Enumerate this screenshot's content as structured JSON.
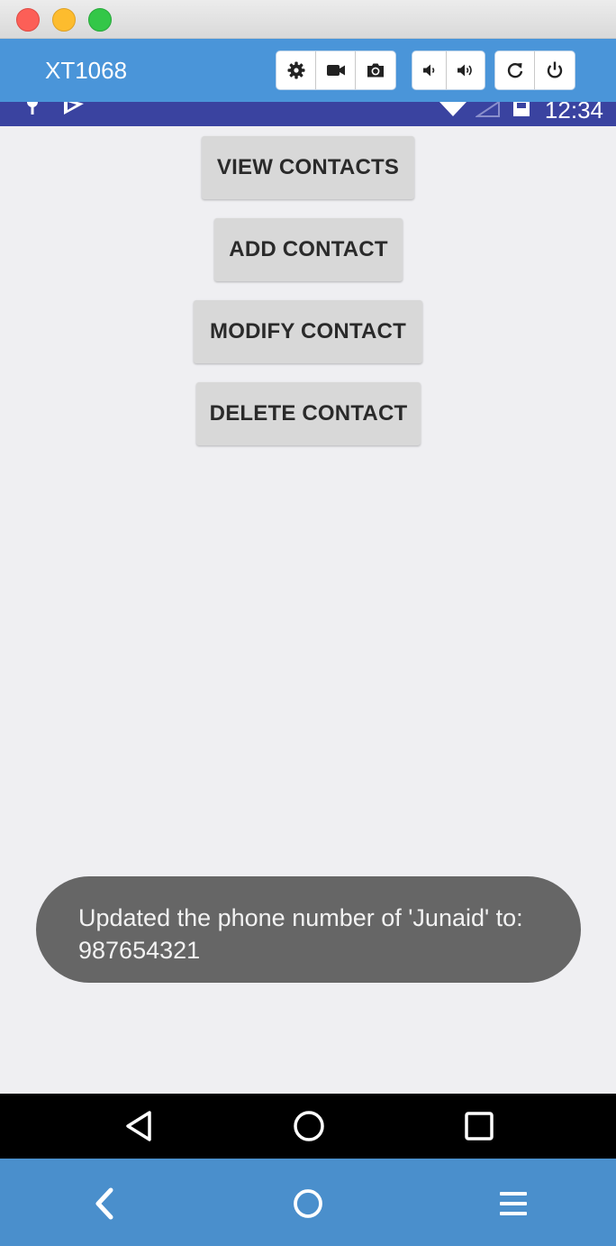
{
  "window": {
    "controls": [
      "close-icon",
      "minimize-icon",
      "maximize-icon"
    ]
  },
  "toolbar": {
    "device_title": "XT1068",
    "icons": [
      "gear-icon",
      "video-camera-icon",
      "camera-icon",
      "volume-down-icon",
      "volume-up-icon",
      "rotate-icon",
      "power-icon"
    ]
  },
  "status_bar": {
    "time": "12:34",
    "icons": [
      "location-icon",
      "play-store-icon",
      "wifi-icon",
      "signal-icon",
      "battery-icon"
    ]
  },
  "app": {
    "buttons": {
      "view": "VIEW CONTACTS",
      "add": "ADD CONTACT",
      "modify": "MODIFY CONTACT",
      "delete": "DELETE CONTACT"
    },
    "toast": {
      "line1": "Updated the phone number of 'Junaid' to:",
      "line2": "987654321"
    }
  },
  "nav_bar": {
    "icons": [
      "back-triangle-icon",
      "home-circle-icon",
      "recents-square-icon"
    ]
  },
  "bottom_bar": {
    "icons": [
      "back-chevron-icon",
      "home-icon",
      "menu-icon"
    ]
  },
  "colors": {
    "toolbar": "#4a95d9",
    "status_bar": "#3a43a0",
    "screen_bg": "#efeff2",
    "button_bg": "#d8d8d8",
    "toast_bg": "#666666",
    "bottom_bar": "#4a8fcc"
  }
}
